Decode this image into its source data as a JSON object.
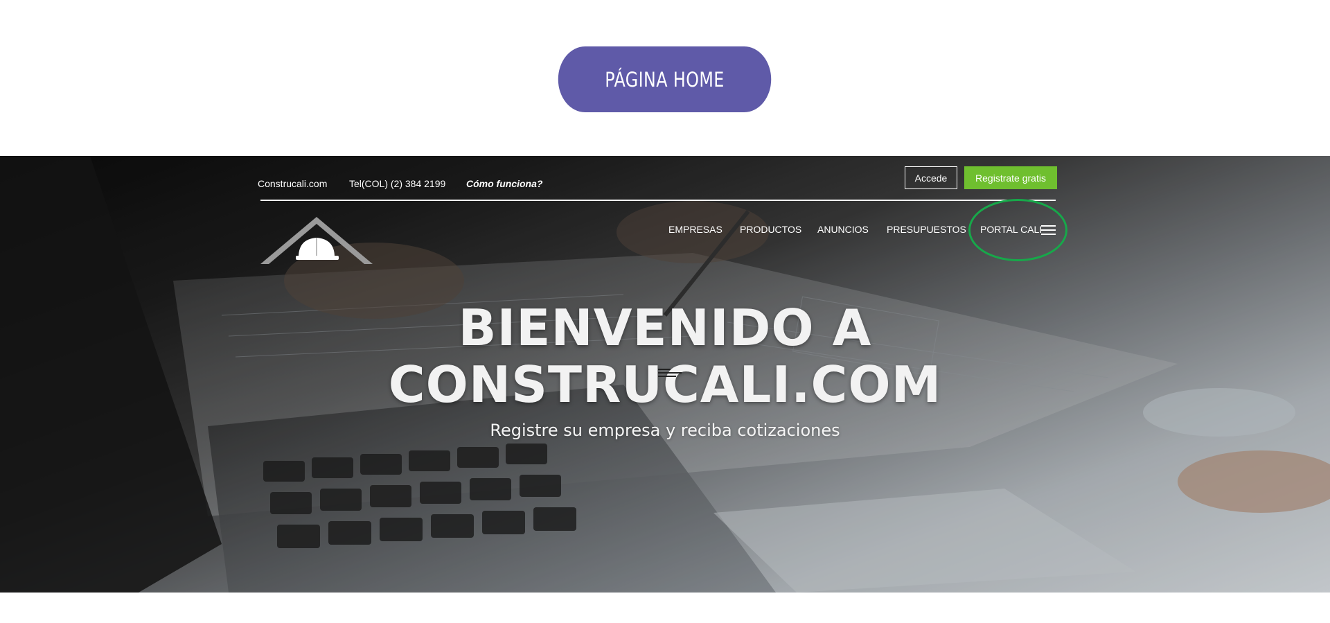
{
  "top": {
    "home_button": "PÁGINA HOME"
  },
  "header": {
    "site_name": "Construcali.com",
    "phone": "Tel(COL) (2) 384 2199",
    "how_it_works": "Cómo funciona?",
    "login_button": "Accede",
    "register_button": "Registrate gratis",
    "register_color": "#6fbf2f",
    "circle_color": "#17a84a"
  },
  "nav": {
    "items": [
      "EMPRESAS",
      "PRODUCTOS",
      "ANUNCIOS",
      "PRESUPUESTOS",
      "PORTAL CALI"
    ]
  },
  "hero": {
    "title_line1": "BIENVENIDO A",
    "title_line2": "CONSTRUCALI.COM",
    "subtitle": "Registre su empresa y reciba cotizaciones"
  },
  "icons": [
    "helmet-logo-icon",
    "hamburger-menu-icon",
    "text-align-icon"
  ]
}
